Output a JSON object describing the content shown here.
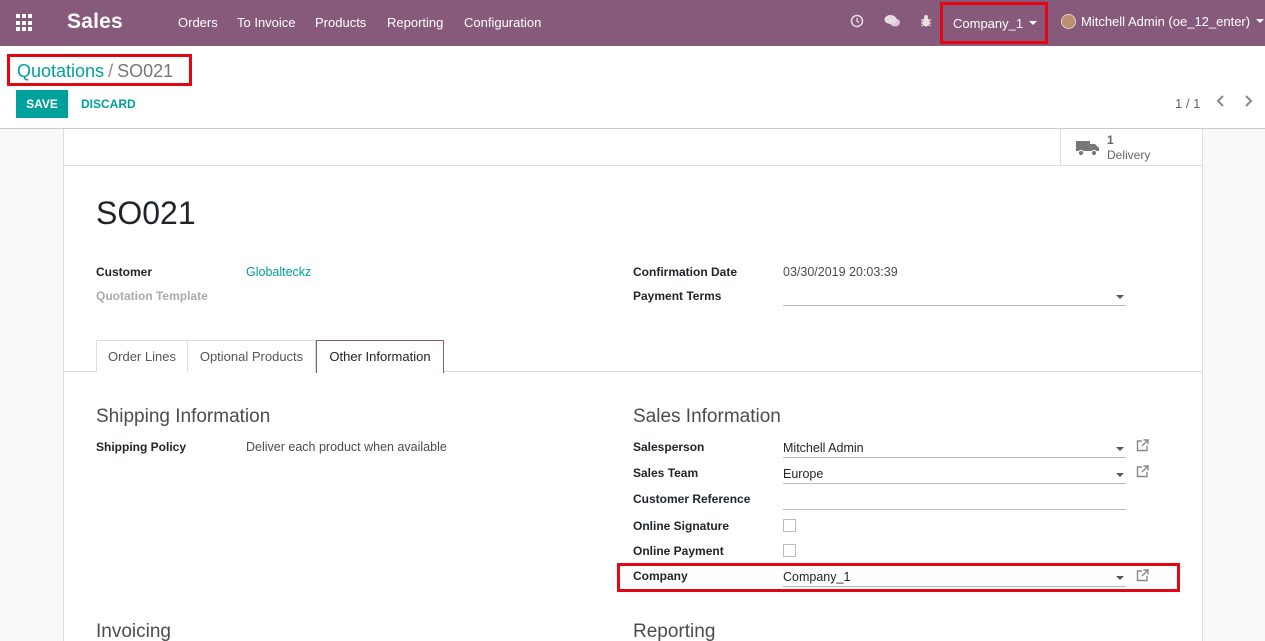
{
  "navbar": {
    "app_name": "Sales",
    "menu": [
      "Orders",
      "To Invoice",
      "Products",
      "Reporting",
      "Configuration"
    ],
    "icons": [
      "clock-icon",
      "chat-icon",
      "bug-icon"
    ],
    "company": "Company_1",
    "user": "Mitchell Admin (oe_12_enter)"
  },
  "breadcrumb": {
    "parent": "Quotations",
    "separator": "/",
    "current": "SO021"
  },
  "buttons": {
    "save": "SAVE",
    "discard": "DISCARD"
  },
  "pager": {
    "value": "1 / 1"
  },
  "smart_button": {
    "count": "1",
    "label": "Delivery",
    "icon": "truck-icon"
  },
  "record": {
    "name": "SO021",
    "customer_label": "Customer",
    "customer_value": "Globalteckz",
    "template_label": "Quotation Template",
    "confirmation_label": "Confirmation Date",
    "confirmation_value": "03/30/2019 20:03:39",
    "payment_terms_label": "Payment Terms",
    "payment_terms_value": ""
  },
  "tabs": [
    "Order Lines",
    "Optional Products",
    "Other Information"
  ],
  "active_tab": "Other Information",
  "shipping": {
    "title": "Shipping Information",
    "policy_label": "Shipping Policy",
    "policy_value": "Deliver each product when available"
  },
  "sales_info": {
    "title": "Sales Information",
    "salesperson_label": "Salesperson",
    "salesperson_value": "Mitchell Admin",
    "team_label": "Sales Team",
    "team_value": "Europe",
    "reference_label": "Customer Reference",
    "reference_value": "",
    "signature_label": "Online Signature",
    "payment_label": "Online Payment",
    "company_label": "Company",
    "company_value": "Company_1"
  },
  "lower_sections": {
    "invoicing": "Invoicing",
    "reporting": "Reporting"
  },
  "colors": {
    "brand": "#875a7b",
    "accent": "#00a09d",
    "highlight": "#e30613"
  }
}
